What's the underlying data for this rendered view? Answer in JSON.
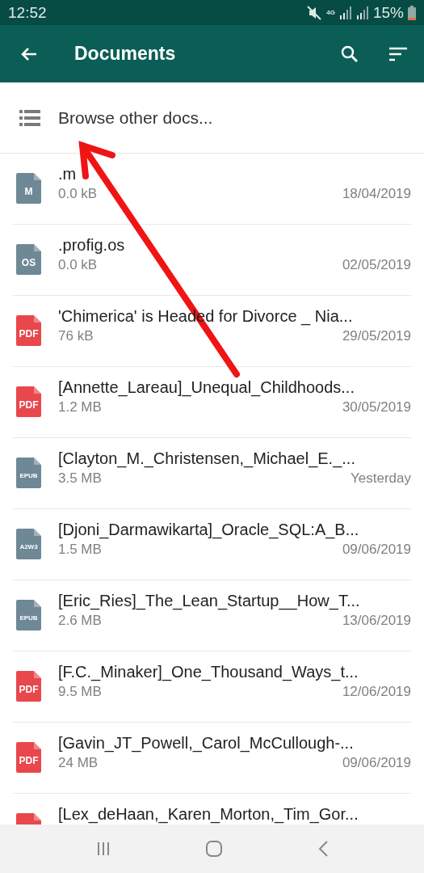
{
  "status_bar": {
    "time": "12:52",
    "network": "4G",
    "battery": "15%"
  },
  "app_bar": {
    "title": "Documents"
  },
  "browse": {
    "label": "Browse other docs..."
  },
  "files": [
    {
      "name": ".m",
      "size": "0.0 kB",
      "date": "18/04/2019",
      "badge": "M",
      "color": "#6f8896"
    },
    {
      "name": ".profig.os",
      "size": "0.0 kB",
      "date": "02/05/2019",
      "badge": "OS",
      "color": "#6f8896"
    },
    {
      "name": "'Chimerica' is Headed for Divorce _ Nia...",
      "size": "76 kB",
      "date": "29/05/2019",
      "badge": "PDF",
      "color": "#e8484c"
    },
    {
      "name": "[Annette_Lareau]_Unequal_Childhoods...",
      "size": "1.2 MB",
      "date": "30/05/2019",
      "badge": "PDF",
      "color": "#e8484c"
    },
    {
      "name": "[Clayton_M._Christensen,_Michael_E._...",
      "size": "3.5 MB",
      "date": "Yesterday",
      "badge": "EPUB",
      "color": "#6f8896"
    },
    {
      "name": "[Djoni_Darmawikarta]_Oracle_SQL:A_B...",
      "size": "1.5 MB",
      "date": "09/06/2019",
      "badge": "A2W3",
      "color": "#6f8896"
    },
    {
      "name": "[Eric_Ries]_The_Lean_Startup__How_T...",
      "size": "2.6 MB",
      "date": "13/06/2019",
      "badge": "EPUB",
      "color": "#6f8896"
    },
    {
      "name": "[F.C._Minaker]_One_Thousand_Ways_t...",
      "size": "9.5 MB",
      "date": "12/06/2019",
      "badge": "PDF",
      "color": "#e8484c"
    },
    {
      "name": "[Gavin_JT_Powell,_Carol_McCullough-...",
      "size": "24 MB",
      "date": "09/06/2019",
      "badge": "PDF",
      "color": "#e8484c"
    },
    {
      "name": "[Lex_deHaan,_Karen_Morton,_Tim_Gor...",
      "color": "#e8484c"
    }
  ]
}
